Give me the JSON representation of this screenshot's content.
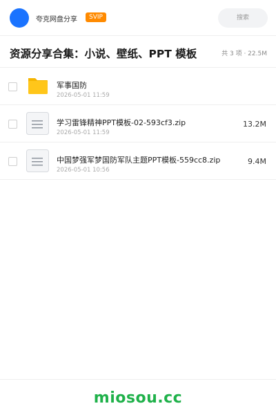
{
  "header": {
    "app_title": "夸克网盘分享",
    "badge": "SVIP",
    "search_placeholder": "搜索"
  },
  "share": {
    "title": "资源分享合集：小说、壁纸、PPT 模板",
    "summary": "共 3 项 · 22.5M"
  },
  "files": [
    {
      "name": "军事国防",
      "date": "2026-05-01 11:59",
      "size": "",
      "type": "folder"
    },
    {
      "name": "学习雷锋精神PPT模板-02-593cf3.zip",
      "date": "2026-05-01 11:59",
      "size": "13.2M",
      "type": "file"
    },
    {
      "name": "中国梦强军梦国防军队主题PPT模板-559cc8.zip",
      "date": "2026-05-01 10:56",
      "size": "9.4M",
      "type": "file"
    }
  ],
  "footer": {
    "brand": "miosou.cc"
  },
  "colors": {
    "avatar": "#1a73ff",
    "svip": "#ff8a00",
    "folder": "#ffc61a",
    "brand": "#1fb14a"
  }
}
